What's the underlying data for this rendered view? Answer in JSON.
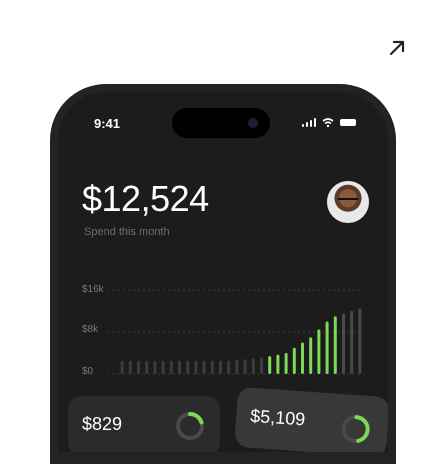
{
  "status_bar": {
    "time": "9:41"
  },
  "header": {
    "balance": "$12,524",
    "subtitle": "Spend this month"
  },
  "chart_data": {
    "type": "bar",
    "y_ticks": [
      "$16k",
      "$8k",
      "$0"
    ],
    "ylim": [
      0,
      16000
    ],
    "grid": true,
    "values": [
      2500,
      2500,
      2500,
      2500,
      2500,
      2500,
      2500,
      2500,
      2500,
      2500,
      2500,
      2500,
      2500,
      2600,
      2700,
      2800,
      3000,
      3200,
      3400,
      3700,
      4000,
      5000,
      6000,
      7000,
      8500,
      10000,
      11000,
      11500,
      12000,
      12500
    ]
  },
  "cards": [
    {
      "value": "$829",
      "progress": 0.2
    },
    {
      "value": "$5,109",
      "progress": 0.45
    }
  ],
  "colors": {
    "accent": "#7ed957",
    "bar_muted": "#3c3c3c",
    "bar_dim": "#4a4a4a"
  }
}
